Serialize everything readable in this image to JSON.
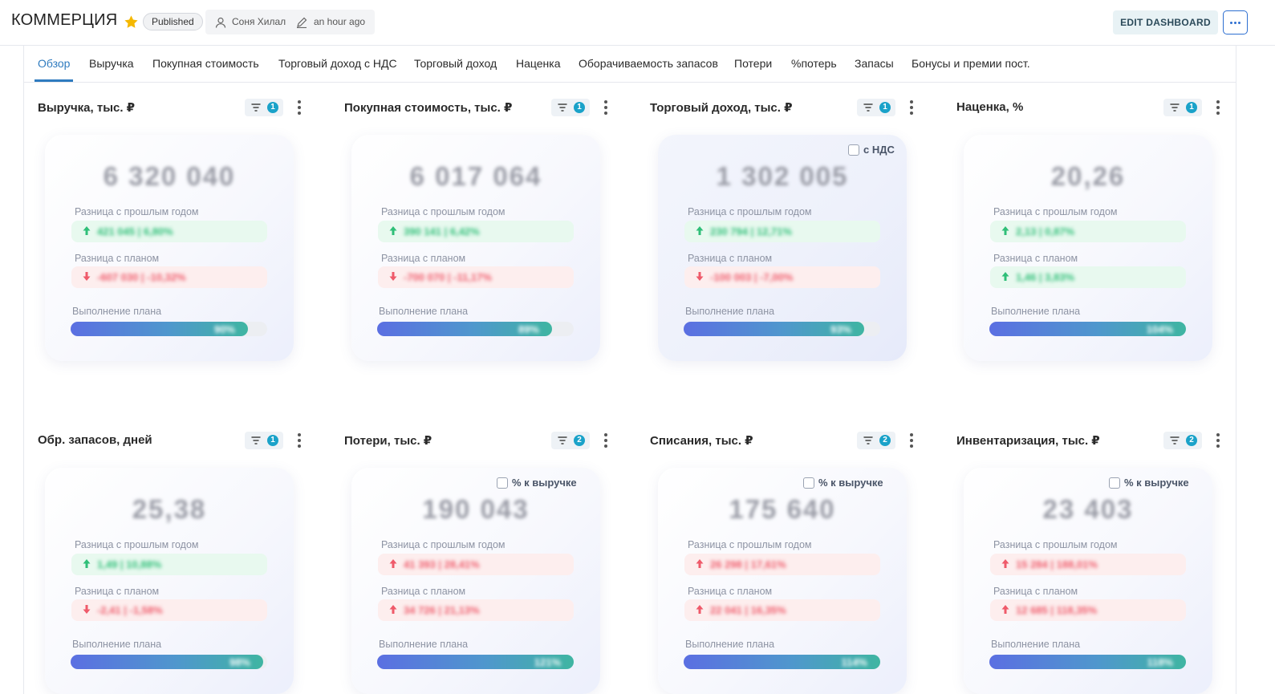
{
  "header": {
    "title": "КОММЕРЦИЯ",
    "status_badge": "Published",
    "author": "Соня Хилал",
    "edited": "an hour ago",
    "edit_button": "EDIT DASHBOARD",
    "more_button_icon": "ellipsis-icon",
    "favorite_icon": "star-icon",
    "colors": {
      "star": "#f5b800",
      "accent": "#2f7bbf",
      "more_border": "#2e6fd1"
    }
  },
  "tabs": [
    {
      "label": "Обзор",
      "active": true
    },
    {
      "label": "Выручка"
    },
    {
      "label": "Покупная стоимость"
    },
    {
      "label": "Торговый доход с НДС"
    },
    {
      "label": "Торговый доход"
    },
    {
      "label": "Наценка"
    },
    {
      "label": "Оборачиваемость запасов"
    },
    {
      "label": "Потери"
    },
    {
      "label": "%потерь"
    },
    {
      "label": "Запасы"
    },
    {
      "label": "Бонусы и премии пост."
    }
  ],
  "labels": {
    "prev_year": "Разница с прошлым годом",
    "plan": "Разница с планом",
    "plan_done": "Выполнение плана"
  },
  "widgets": [
    {
      "title": "Выручка, тыс. ₽",
      "filters": "1",
      "value": "6 320 040",
      "checkbox": null,
      "prev": {
        "dir": "up",
        "color": "green",
        "text": "421 045 | 6,80%"
      },
      "plan": {
        "dir": "down",
        "color": "red",
        "text": "-607 030 | -10,32%"
      },
      "progress": {
        "text": "90%",
        "fraction": 0.9
      }
    },
    {
      "title": "Покупная стоимость, тыс. ₽",
      "filters": "1",
      "value": "6 017 064",
      "checkbox": null,
      "prev": {
        "dir": "up",
        "color": "green",
        "text": "390 141 | 6,42%"
      },
      "plan": {
        "dir": "down",
        "color": "red",
        "text": "-700 070 | -11,17%"
      },
      "progress": {
        "text": "89%",
        "fraction": 0.89
      }
    },
    {
      "title": "Торговый доход, тыс. ₽",
      "filters": "1",
      "value": "1 302 005",
      "checkbox": "с НДС",
      "tinted": true,
      "prev": {
        "dir": "up",
        "color": "green",
        "text": "230 794 | 12,71%"
      },
      "plan": {
        "dir": "down",
        "color": "red",
        "text": "-100 003 | -7,00%"
      },
      "progress": {
        "text": "93%",
        "fraction": 0.92
      }
    },
    {
      "title": "Наценка, %",
      "filters": "1",
      "value": "20,26",
      "checkbox": null,
      "prev": {
        "dir": "up",
        "color": "green",
        "text": "2,13 | 0,87%"
      },
      "plan": {
        "dir": "up",
        "color": "green",
        "text": "1,46 | 3,83%"
      },
      "progress": {
        "text": "104%",
        "fraction": 1.0
      }
    },
    {
      "title": "Обр. запасов, дней",
      "filters": "1",
      "value": "25,38",
      "checkbox": null,
      "prev": {
        "dir": "up",
        "color": "green",
        "text": "1,49 | 10,88%"
      },
      "plan": {
        "dir": "down",
        "color": "red",
        "text": "-2,41 | -1,58%"
      },
      "progress": {
        "text": "98%",
        "fraction": 0.98
      }
    },
    {
      "title": "Потери, тыс. ₽",
      "filters": "2",
      "value": "190 043",
      "checkbox": "% к выручке",
      "prev": {
        "dir": "up",
        "color": "red",
        "text": "41 393 | 28,41%"
      },
      "plan": {
        "dir": "up",
        "color": "red",
        "text": "34 726 | 21,13%"
      },
      "progress": {
        "text": "121%",
        "fraction": 1.0
      }
    },
    {
      "title": "Списания, тыс. ₽",
      "filters": "2",
      "value": "175 640",
      "checkbox": "% к выручке",
      "prev": {
        "dir": "up",
        "color": "red",
        "text": "26 298 | 17,61%"
      },
      "plan": {
        "dir": "up",
        "color": "red",
        "text": "22 041 | 16,35%"
      },
      "progress": {
        "text": "114%",
        "fraction": 1.0
      }
    },
    {
      "title": "Инвентаризация, тыс. ₽",
      "filters": "2",
      "value": "23 403",
      "checkbox": "% к выручке",
      "prev": {
        "dir": "up",
        "color": "red",
        "text": "15 284 | 188,01%"
      },
      "plan": {
        "dir": "up",
        "color": "red",
        "text": "12 685 | 118,35%"
      },
      "progress": {
        "text": "118%",
        "fraction": 1.0
      }
    }
  ]
}
